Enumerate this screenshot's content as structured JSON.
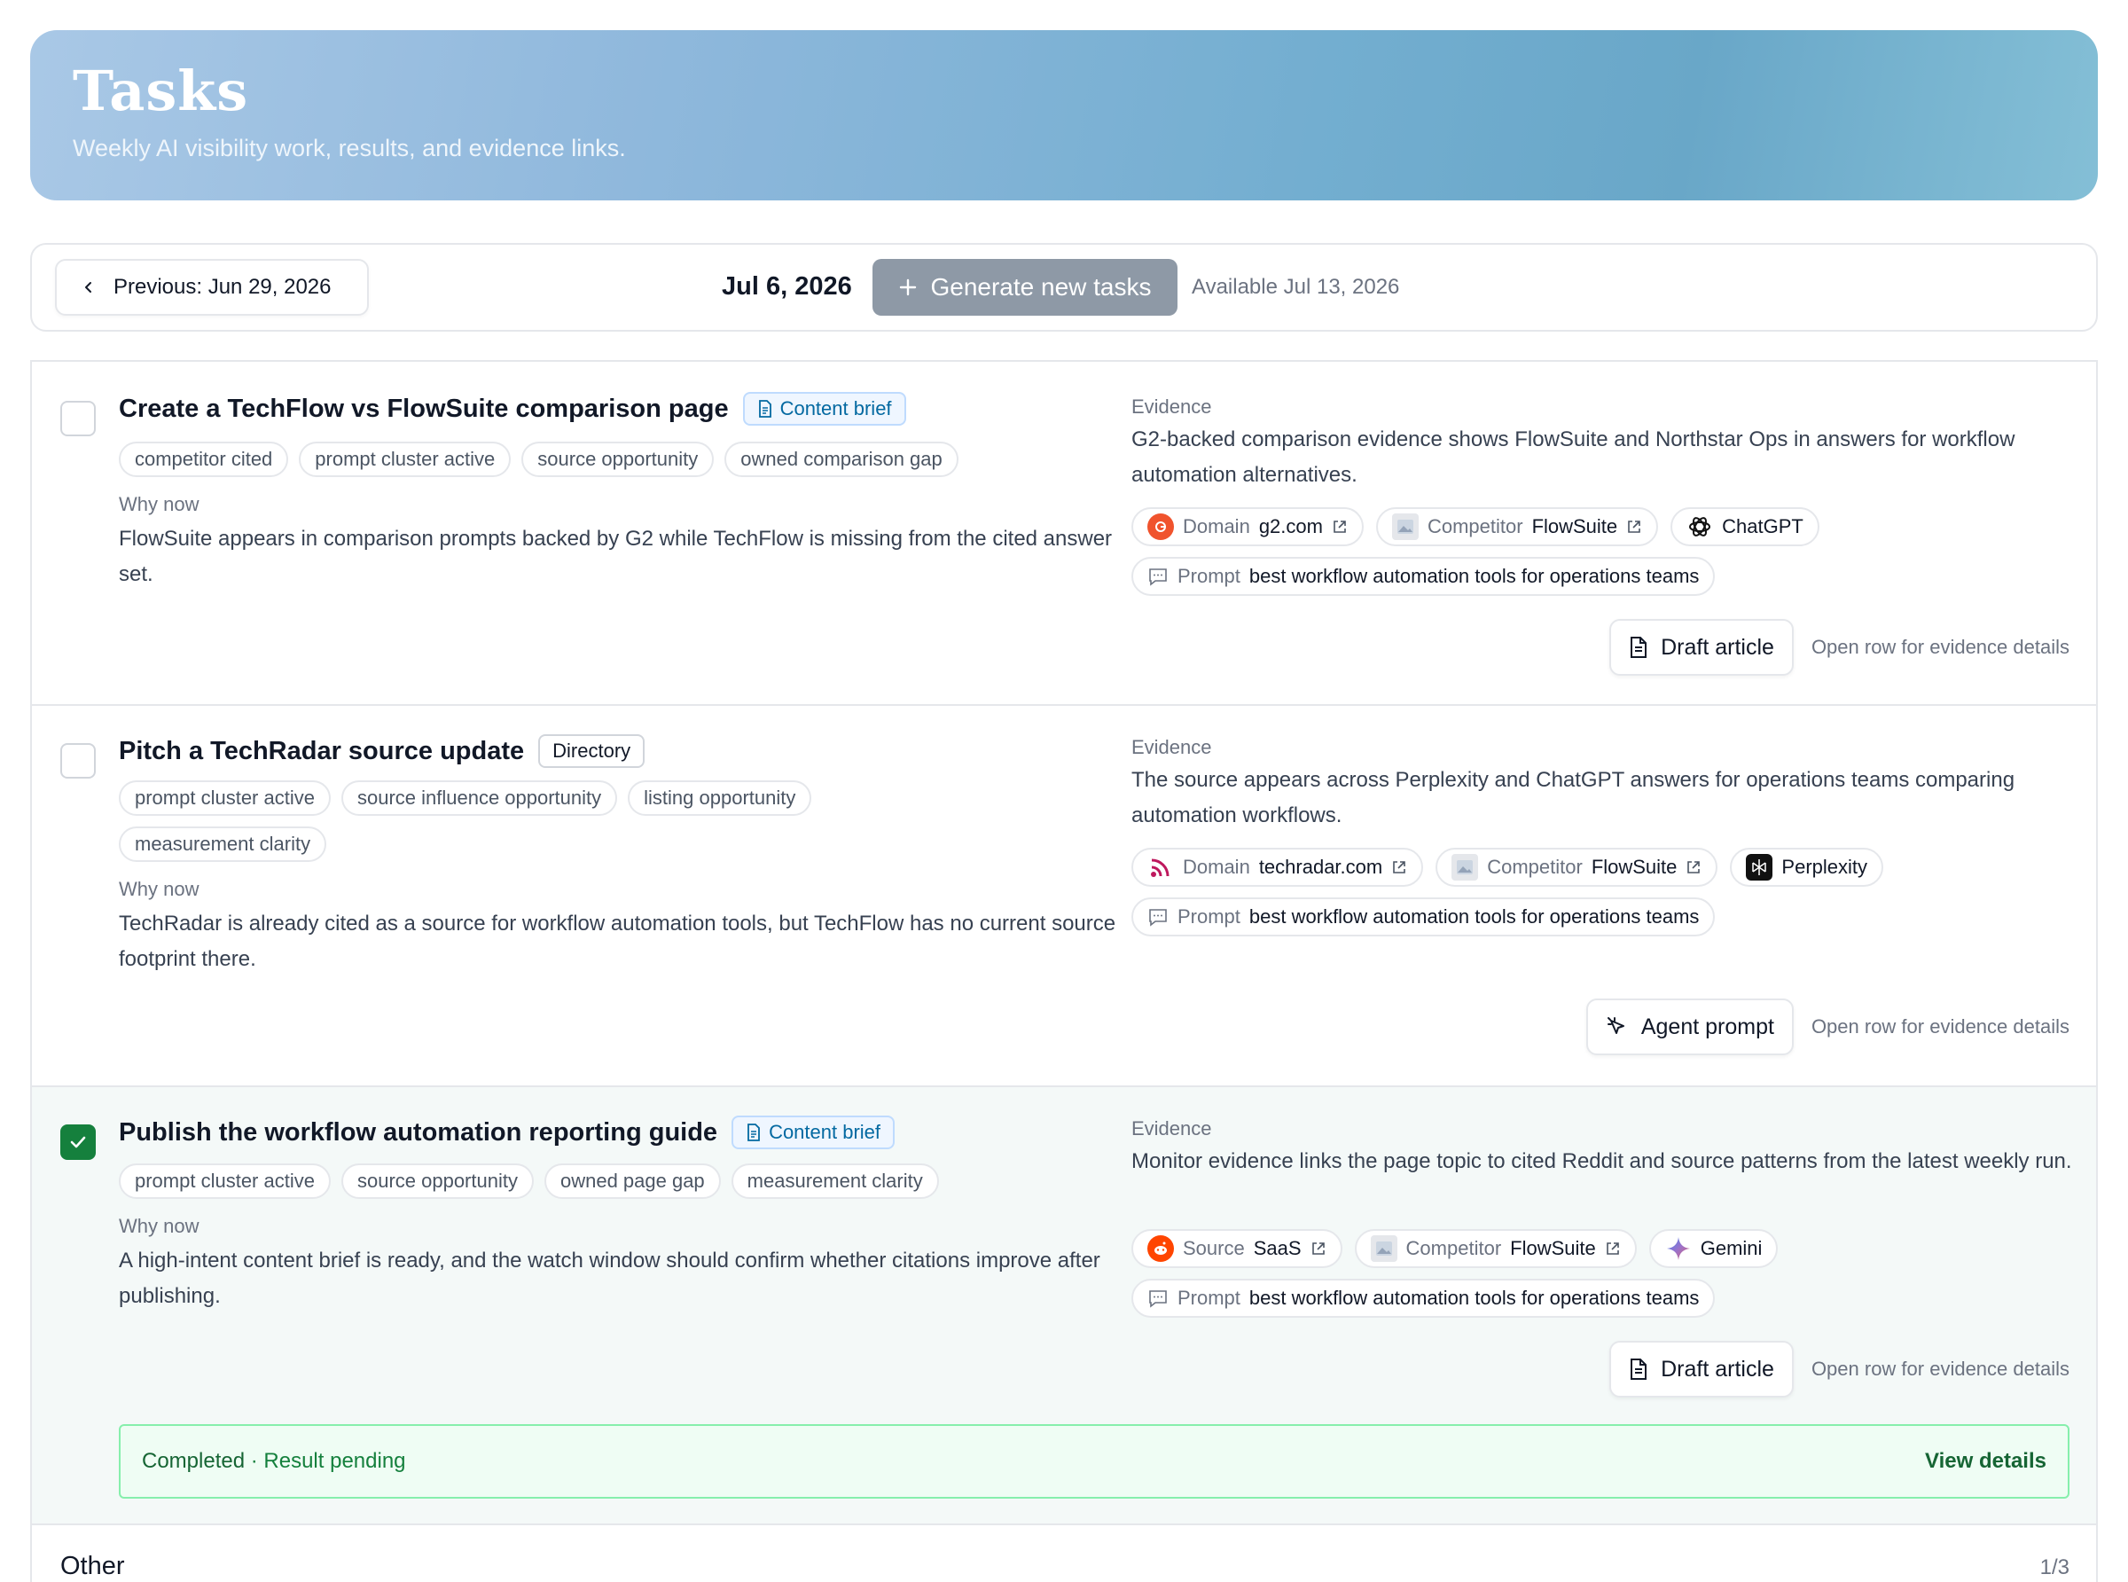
{
  "header": {
    "title": "Tasks",
    "subtitle": "Weekly AI visibility work, results, and evidence links."
  },
  "week_nav": {
    "previous_label": "Previous: Jun 29, 2026",
    "current_date": "Jul 6, 2026",
    "generate_label": "Generate new tasks",
    "available_text": "Available Jul 13, 2026"
  },
  "tasks": [
    {
      "title": "Create a TechFlow vs FlowSuite comparison page",
      "badge": "Content brief",
      "tags": [
        "competitor cited",
        "prompt cluster active",
        "source opportunity",
        "owned comparison gap"
      ],
      "why_label": "Why now",
      "why": "FlowSuite appears in comparison prompts backed by G2 while TechFlow is missing from the cited answer set.",
      "evidence_label": "Evidence",
      "evidence": "G2-backed comparison evidence shows FlowSuite and Northstar Ops in answers for workflow automation alternatives.",
      "chips": [
        {
          "kind": "Domain",
          "value": "g2.com",
          "icon": "g2-icon"
        },
        {
          "kind": "Competitor",
          "value": "FlowSuite",
          "icon": "image-placeholder-icon"
        },
        {
          "kind": "",
          "value": "ChatGPT",
          "icon": "chatgpt-icon"
        }
      ],
      "prompt": {
        "kind": "Prompt",
        "value": "best workflow automation tools for operations teams"
      },
      "action_label": "Draft article",
      "open_row_text": "Open row for evidence details",
      "checked": false
    },
    {
      "title": "Pitch a TechRadar source update",
      "badge": "Directory",
      "tags": [
        "prompt cluster active",
        "source influence opportunity",
        "listing opportunity",
        "measurement clarity"
      ],
      "why_label": "Why now",
      "why": "TechRadar is already cited as a source for workflow automation tools, but TechFlow has no current source footprint there.",
      "evidence_label": "Evidence",
      "evidence": "The source appears across Perplexity and ChatGPT answers for operations teams comparing automation workflows.",
      "chips": [
        {
          "kind": "Domain",
          "value": "techradar.com",
          "icon": "techradar-icon"
        },
        {
          "kind": "Competitor",
          "value": "FlowSuite",
          "icon": "image-placeholder-icon"
        },
        {
          "kind": "",
          "value": "Perplexity",
          "icon": "perplexity-icon"
        }
      ],
      "prompt": {
        "kind": "Prompt",
        "value": "best workflow automation tools for operations teams"
      },
      "action_label": "Agent prompt",
      "open_row_text": "Open row for evidence details",
      "checked": false
    },
    {
      "title": "Publish the workflow automation reporting guide",
      "badge": "Content brief",
      "tags": [
        "prompt cluster active",
        "source opportunity",
        "owned page gap",
        "measurement clarity"
      ],
      "why_label": "Why now",
      "why": "A high-intent content brief is ready, and the watch window should confirm whether citations improve after publishing.",
      "evidence_label": "Evidence",
      "evidence": "Monitor evidence links the page topic to cited Reddit and source patterns from the latest weekly run.",
      "chips": [
        {
          "kind": "Source",
          "value": "SaaS",
          "icon": "reddit-icon"
        },
        {
          "kind": "Competitor",
          "value": "FlowSuite",
          "icon": "image-placeholder-icon"
        },
        {
          "kind": "",
          "value": "Gemini",
          "icon": "gemini-icon"
        }
      ],
      "prompt": {
        "kind": "Prompt",
        "value": "best workflow automation tools for operations teams"
      },
      "action_label": "Draft article",
      "open_row_text": "Open row for evidence details",
      "checked": true,
      "result": {
        "status": "Completed",
        "detail": "· Result pending",
        "link": "View details"
      }
    }
  ],
  "other": {
    "label": "Other",
    "count": "1/3"
  },
  "colors": {
    "accent_green": "#15803d",
    "brief_blue": "#0369a1",
    "disabled_button": "#8e99a6"
  }
}
